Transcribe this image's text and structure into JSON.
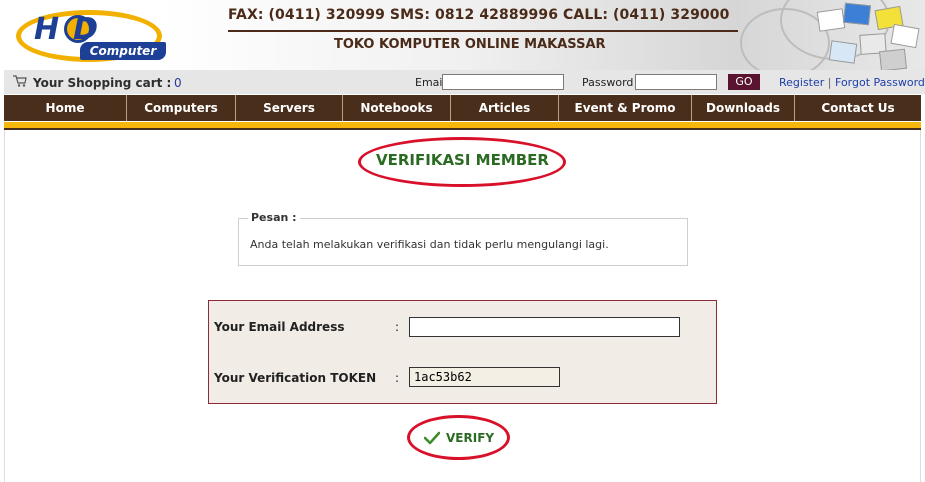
{
  "brand": {
    "logo_letters": "HD",
    "logo_sub": "Computer",
    "contact_line": "FAX: (0411) 320999  SMS: 0812 42889996  CALL: (0411) 329000",
    "store_name": "TOKO KOMPUTER ONLINE MAKASSAR"
  },
  "loginbar": {
    "cart_label": "Your Shopping cart  :",
    "cart_count": "0",
    "email_label": "Email",
    "email_value": "",
    "password_label": "Password",
    "password_value": "",
    "go_label": "GO",
    "register_label": "Register",
    "separator": "|",
    "forgot_label": "Forgot Password?"
  },
  "nav": {
    "items": [
      {
        "label": "Home"
      },
      {
        "label": "Computers"
      },
      {
        "label": "Servers"
      },
      {
        "label": "Notebooks"
      },
      {
        "label": "Articles"
      },
      {
        "label": "Event & Promo"
      },
      {
        "label": "Downloads"
      },
      {
        "label": "Contact Us"
      }
    ]
  },
  "main": {
    "title": "VERIFIKASI MEMBER",
    "message_legend": "Pesan :",
    "message_text": "Anda telah melakukan verifikasi dan tidak perlu mengulangi lagi.",
    "form": {
      "email_label": "Your Email Address",
      "email_value": "",
      "token_label": "Your Verification TOKEN",
      "token_value": "1ac53b62",
      "colon": ":"
    },
    "verify_label": "VERIFY"
  },
  "colors": {
    "nav_bg": "#4a2e1c",
    "accent_yellow": "#f5b70b",
    "title_green": "#2b6a22",
    "highlight_red": "#d8102a",
    "go_button": "#5b1430"
  },
  "icons": {
    "cart": "shopping-cart-icon",
    "verify": "checkmark-icon"
  }
}
